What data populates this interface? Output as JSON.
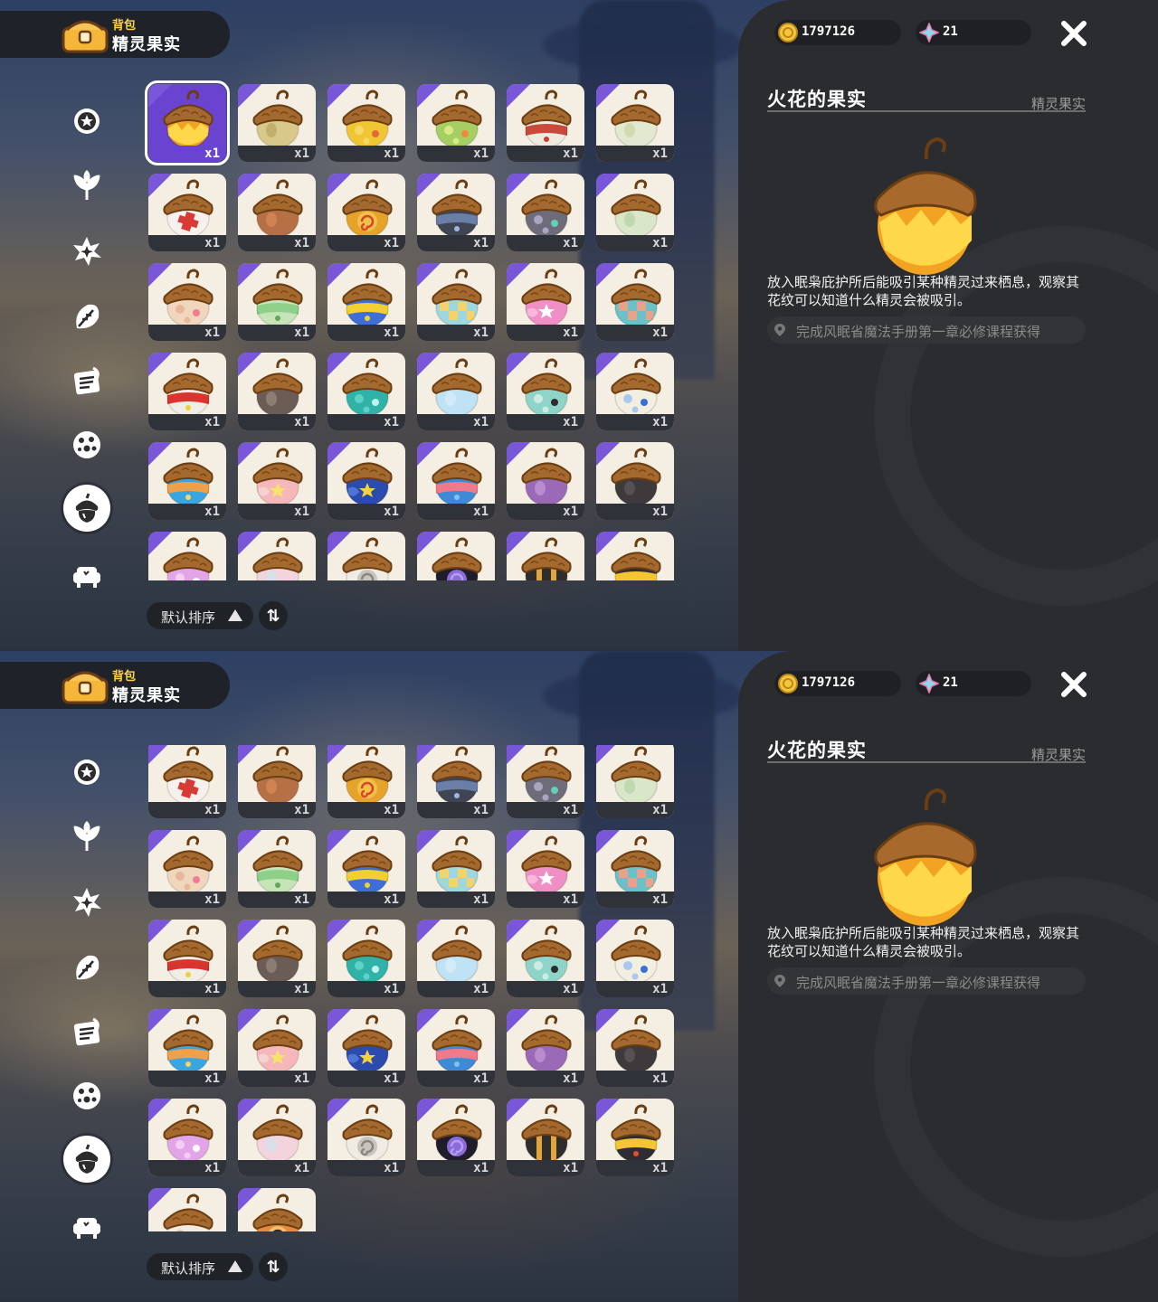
{
  "header": {
    "subtitle": "背包",
    "title": "精灵果实"
  },
  "currency": {
    "coins": "1797126",
    "gems": "21"
  },
  "detail": {
    "name": "火花的果实",
    "category": "精灵果实",
    "description": "放入眠枭庇护所后能吸引某种精灵过来栖息，观察其花纹可以知道什么精灵会被吸引。",
    "source": "完成风眠省魔法手册第一章必修课程获得"
  },
  "sort": {
    "label": "默认排序"
  },
  "nav_icons": [
    "star-badge-icon",
    "leaf-sprout-icon",
    "sparkle-burst-icon",
    "leaves-icon",
    "scroll-icon",
    "dotted-ball-icon",
    "acorn-icon",
    "sofa-icon"
  ],
  "fruits": [
    {
      "qty": "x1",
      "base": "#f2a321",
      "band": "#ffd84a",
      "accent": "#e0542a",
      "pattern": "zigzag"
    },
    {
      "qty": "x1",
      "base": "#d7c98a",
      "band": "#b9a65f",
      "accent": "#8d7b3d",
      "pattern": "plain"
    },
    {
      "qty": "x1",
      "base": "#f0c733",
      "band": "#f5d865",
      "accent": "#e56735",
      "pattern": "spots"
    },
    {
      "qty": "x1",
      "base": "#a5cf62",
      "band": "#d9e984",
      "accent": "#f08a3a",
      "pattern": "spots"
    },
    {
      "qty": "x1",
      "base": "#eeeae0",
      "band": "#c94a3a",
      "accent": "#cc3d31",
      "pattern": "band"
    },
    {
      "qty": "x1",
      "base": "#e3e8d1",
      "band": "#c9d6a4",
      "accent": "#9aa978",
      "pattern": "plain"
    },
    {
      "qty": "x1",
      "base": "#f6f1ec",
      "band": "#e8e1da",
      "accent": "#d83a35",
      "pattern": "cross"
    },
    {
      "qty": "x1",
      "base": "#b77045",
      "band": "#d98a58",
      "accent": "#8a4828",
      "pattern": "plain"
    },
    {
      "qty": "x1",
      "base": "#e6a32a",
      "band": "#f0c24a",
      "accent": "#d8452a",
      "pattern": "swirl"
    },
    {
      "qty": "x1",
      "base": "#3f4552",
      "band": "#6b7ea8",
      "accent": "#9fb5e6",
      "pattern": "band"
    },
    {
      "qty": "x1",
      "base": "#6e6b7a",
      "band": "#a9a6c2",
      "accent": "#62d1b5",
      "pattern": "spots"
    },
    {
      "qty": "x1",
      "base": "#d9e6c8",
      "band": "#b4d1a4",
      "accent": "#7fb070",
      "pattern": "plain"
    },
    {
      "qty": "x1",
      "base": "#f1d6be",
      "band": "#e6b99a",
      "accent": "#f27d92",
      "pattern": "spots"
    },
    {
      "qty": "x1",
      "base": "#c7e4b8",
      "band": "#8ed08a",
      "accent": "#5fa85a",
      "pattern": "band"
    },
    {
      "qty": "x1",
      "base": "#3e6fd8",
      "band": "#f2cf32",
      "accent": "#f2cf32",
      "pattern": "band"
    },
    {
      "qty": "x1",
      "base": "#9fd7e0",
      "band": "#f3d36a",
      "accent": "#7ac0d0",
      "pattern": "checker"
    },
    {
      "qty": "x1",
      "base": "#f08ec6",
      "band": "#f7b8dc",
      "accent": "#ffffff",
      "pattern": "star"
    },
    {
      "qty": "x1",
      "base": "#6cc0c9",
      "band": "#e6a38a",
      "accent": "#f09a72",
      "pattern": "checker"
    },
    {
      "qty": "x1",
      "base": "#f0ece6",
      "band": "#d9352f",
      "accent": "#f2cf32",
      "pattern": "band"
    },
    {
      "qty": "x1",
      "base": "#6b5c55",
      "band": "#9a8b80",
      "accent": "#c8bcb0",
      "pattern": "plain"
    },
    {
      "qty": "x1",
      "base": "#2fb3a8",
      "band": "#5fd1c6",
      "accent": "#bff5ee",
      "pattern": "spots"
    },
    {
      "qty": "x1",
      "base": "#bfe2f4",
      "band": "#dbeffa",
      "accent": "#8dbfe0",
      "pattern": "plain"
    },
    {
      "qty": "x1",
      "base": "#8ed4c8",
      "band": "#cdebe3",
      "accent": "#2d2d2d",
      "pattern": "spots"
    },
    {
      "qty": "x1",
      "base": "#f3efe0",
      "band": "#a9c8f0",
      "accent": "#3a6fd8",
      "pattern": "spots"
    },
    {
      "qty": "x1",
      "base": "#3aa6e0",
      "band": "#f1a04a",
      "accent": "#f7d36a",
      "pattern": "band"
    },
    {
      "qty": "x1",
      "base": "#f6b7ba",
      "band": "#f4d2cf",
      "accent": "#f5e36a",
      "pattern": "star"
    },
    {
      "qty": "x1",
      "base": "#2b4cae",
      "band": "#4f74d8",
      "accent": "#f5d33a",
      "pattern": "star"
    },
    {
      "qty": "x1",
      "base": "#3f8ad6",
      "band": "#f07a8a",
      "accent": "#86c0f0",
      "pattern": "band"
    },
    {
      "qty": "x1",
      "base": "#9a6ab8",
      "band": "#c59ad8",
      "accent": "#f2c5e8",
      "pattern": "plain"
    },
    {
      "qty": "x1",
      "base": "#3e3a3c",
      "band": "#5f5a5c",
      "accent": "#8a8486",
      "pattern": "plain"
    },
    {
      "qty": "x1",
      "base": "#e2a6e8",
      "band": "#f3cdf2",
      "accent": "#ffffff",
      "pattern": "spots"
    },
    {
      "qty": "x1",
      "base": "#f3d4dc",
      "band": "#cfe6f0",
      "accent": "#f6b3c6",
      "pattern": "plain"
    },
    {
      "qty": "x1",
      "base": "#f0ece4",
      "band": "#c9c5be",
      "accent": "#8a8680",
      "pattern": "swirl"
    },
    {
      "qty": "x1",
      "base": "#1f1d2a",
      "band": "#8c6ad8",
      "accent": "#b49cf0",
      "pattern": "swirl"
    },
    {
      "qty": "x1",
      "base": "#2e2c2c",
      "band": "#e2a638",
      "accent": "#f5c44a",
      "pattern": "stripes"
    },
    {
      "qty": "x1",
      "base": "#2e2d33",
      "band": "#f5c533",
      "accent": "#e0502f",
      "pattern": "band"
    },
    {
      "qty": "x1",
      "base": "#f3ebe0",
      "band": "#d8cab8",
      "accent": "#2d2d2d",
      "pattern": "spots"
    },
    {
      "qty": "x1",
      "base": "#e58a3a",
      "band": "#f4c074",
      "accent": "#3e2a20",
      "pattern": "swirl"
    }
  ]
}
